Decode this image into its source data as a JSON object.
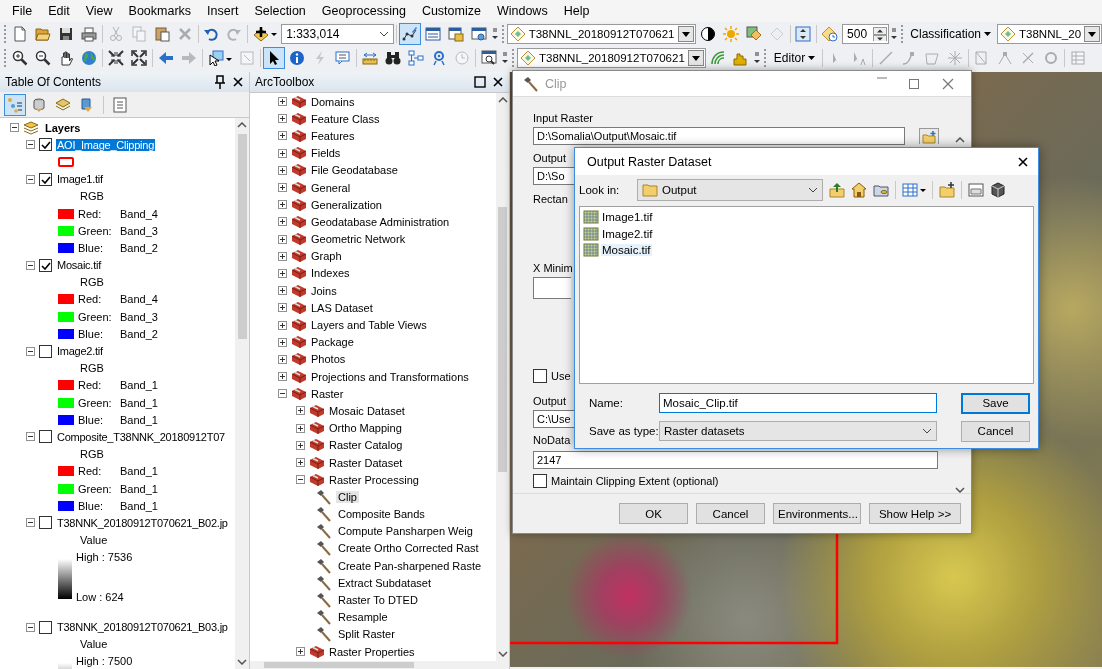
{
  "menu": [
    "File",
    "Edit",
    "View",
    "Bookmarks",
    "Insert",
    "Selection",
    "Geoprocessing",
    "Customize",
    "Windows",
    "Help"
  ],
  "toolbars": [
    {
      "items": [
        {
          "kind": "grip"
        },
        {
          "kind": "button",
          "disabled": false,
          "pressed": false
        },
        {
          "kind": "button",
          "disabled": false,
          "pressed": false
        },
        {
          "kind": "button",
          "disabled": false,
          "pressed": false
        },
        {
          "kind": "button",
          "disabled": false,
          "pressed": false
        },
        {
          "kind": "sep"
        },
        {
          "kind": "button",
          "disabled": true,
          "pressed": false
        },
        {
          "kind": "button",
          "disabled": true,
          "pressed": false
        },
        {
          "kind": "button",
          "disabled": false,
          "pressed": false
        },
        {
          "kind": "button",
          "disabled": true,
          "pressed": false
        },
        {
          "kind": "sep"
        },
        {
          "kind": "button",
          "disabled": false,
          "pressed": false
        },
        {
          "kind": "button",
          "disabled": true,
          "pressed": false
        },
        {
          "kind": "sep"
        },
        {
          "kind": "button",
          "disabled": false,
          "pressed": false
        },
        {
          "kind": "combo",
          "value": "1:333,014"
        },
        {
          "kind": "sep"
        },
        {
          "kind": "button",
          "disabled": false,
          "pressed": true
        },
        {
          "kind": "button",
          "disabled": false,
          "pressed": false
        },
        {
          "kind": "button",
          "disabled": false,
          "pressed": false
        },
        {
          "kind": "button",
          "disabled": false,
          "pressed": false
        },
        {
          "kind": "options"
        },
        {
          "kind": "grip"
        },
        {
          "kind": "dropdown",
          "value": "T38NNL_20180912T070621"
        },
        {
          "kind": "button",
          "disabled": false,
          "pressed": false
        },
        {
          "kind": "button",
          "disabled": false,
          "pressed": false
        },
        {
          "kind": "button",
          "disabled": false,
          "pressed": false
        },
        {
          "kind": "button",
          "disabled": true,
          "pressed": false
        },
        {
          "kind": "sep"
        },
        {
          "kind": "button",
          "disabled": false,
          "pressed": false
        },
        {
          "kind": "sep"
        },
        {
          "kind": "button",
          "disabled": false,
          "pressed": false
        },
        {
          "kind": "spin",
          "value": "500"
        },
        {
          "kind": "options"
        },
        {
          "kind": "grip"
        },
        {
          "kind": "menu",
          "label": "Classification"
        },
        {
          "kind": "dropdown",
          "value": "T38NNL_20"
        }
      ]
    },
    {
      "items": [
        {
          "kind": "grip"
        },
        {
          "kind": "button",
          "disabled": false,
          "pressed": false
        },
        {
          "kind": "button",
          "disabled": false,
          "pressed": false
        },
        {
          "kind": "button",
          "disabled": false,
          "pressed": false
        },
        {
          "kind": "button",
          "disabled": false,
          "pressed": false
        },
        {
          "kind": "sep"
        },
        {
          "kind": "button",
          "disabled": false,
          "pressed": false
        },
        {
          "kind": "button",
          "disabled": false,
          "pressed": false
        },
        {
          "kind": "sep"
        },
        {
          "kind": "button",
          "disabled": false,
          "pressed": false
        },
        {
          "kind": "button",
          "disabled": true,
          "pressed": false
        },
        {
          "kind": "sep"
        },
        {
          "kind": "button",
          "disabled": false,
          "pressed": false
        },
        {
          "kind": "button",
          "disabled": true,
          "pressed": false
        },
        {
          "kind": "sep"
        },
        {
          "kind": "button",
          "disabled": false,
          "pressed": true
        },
        {
          "kind": "button",
          "disabled": false,
          "pressed": false
        },
        {
          "kind": "button",
          "disabled": true,
          "pressed": false
        },
        {
          "kind": "button",
          "disabled": false,
          "pressed": false
        },
        {
          "kind": "sep"
        },
        {
          "kind": "button",
          "disabled": false,
          "pressed": false
        },
        {
          "kind": "button",
          "disabled": false,
          "pressed": false
        },
        {
          "kind": "button",
          "disabled": false,
          "pressed": false
        },
        {
          "kind": "button",
          "disabled": false,
          "pressed": false
        },
        {
          "kind": "button",
          "disabled": true,
          "pressed": false
        },
        {
          "kind": "sep"
        },
        {
          "kind": "button",
          "disabled": false,
          "pressed": false
        },
        {
          "kind": "options"
        },
        {
          "kind": "grip"
        },
        {
          "kind": "dropdown",
          "value": "T38NNL_20180912T070621"
        },
        {
          "kind": "button",
          "disabled": false,
          "pressed": false
        },
        {
          "kind": "button",
          "disabled": false,
          "pressed": false
        },
        {
          "kind": "options"
        },
        {
          "kind": "grip"
        },
        {
          "kind": "menu",
          "label": "Editor"
        },
        {
          "kind": "sep"
        },
        {
          "kind": "button",
          "disabled": true,
          "pressed": false
        },
        {
          "kind": "button",
          "disabled": true,
          "pressed": false
        },
        {
          "kind": "sep"
        },
        {
          "kind": "button",
          "disabled": true,
          "pressed": false
        },
        {
          "kind": "button",
          "disabled": true,
          "pressed": false
        },
        {
          "kind": "button",
          "disabled": true,
          "pressed": false
        },
        {
          "kind": "button",
          "disabled": true,
          "pressed": false
        },
        {
          "kind": "sep"
        },
        {
          "kind": "button",
          "disabled": true,
          "pressed": false
        },
        {
          "kind": "button",
          "disabled": true,
          "pressed": false
        },
        {
          "kind": "button",
          "disabled": true,
          "pressed": false
        },
        {
          "kind": "button",
          "disabled": true,
          "pressed": false
        },
        {
          "kind": "sep"
        },
        {
          "kind": "button",
          "disabled": true,
          "pressed": false
        }
      ]
    }
  ],
  "toc": {
    "title": "Table Of Contents",
    "views": [
      {
        "selected": true
      },
      {
        "selected": false
      },
      {
        "selected": false
      },
      {
        "selected": false
      }
    ],
    "root": {
      "label": "Layers",
      "expanded": true
    },
    "layers": [
      {
        "name": "AOI_Image_Clipping",
        "checked": true,
        "selected": true,
        "expanded": true,
        "legend": [
          {
            "kind": "outline",
            "color": "#ff0000"
          }
        ]
      },
      {
        "name": "Image1.tif",
        "checked": true,
        "selected": false,
        "expanded": true,
        "legend": [
          {
            "kind": "heading",
            "text": "RGB"
          },
          {
            "kind": "band",
            "label": "Red:",
            "value": "Band_4",
            "color": "#ff0000"
          },
          {
            "kind": "band",
            "label": "Green:",
            "value": "Band_3",
            "color": "#00ff00"
          },
          {
            "kind": "band",
            "label": "Blue:",
            "value": "Band_2",
            "color": "#0000ff"
          }
        ]
      },
      {
        "name": "Mosaic.tif",
        "checked": true,
        "selected": false,
        "expanded": true,
        "legend": [
          {
            "kind": "heading",
            "text": "RGB"
          },
          {
            "kind": "band",
            "label": "Red:",
            "value": "Band_4",
            "color": "#ff0000"
          },
          {
            "kind": "band",
            "label": "Green:",
            "value": "Band_3",
            "color": "#00ff00"
          },
          {
            "kind": "band",
            "label": "Blue:",
            "value": "Band_2",
            "color": "#0000ff"
          }
        ]
      },
      {
        "name": "Image2.tif",
        "checked": false,
        "selected": false,
        "expanded": true,
        "legend": [
          {
            "kind": "heading",
            "text": "RGB"
          },
          {
            "kind": "band",
            "label": "Red:",
            "value": "Band_1",
            "color": "#ff0000"
          },
          {
            "kind": "band",
            "label": "Green:",
            "value": "Band_1",
            "color": "#00ff00"
          },
          {
            "kind": "band",
            "label": "Blue:",
            "value": "Band_1",
            "color": "#0000ff"
          }
        ]
      },
      {
        "name": "Composite_T38NNK_20180912T07",
        "checked": false,
        "selected": false,
        "expanded": true,
        "legend": [
          {
            "kind": "heading",
            "text": "RGB"
          },
          {
            "kind": "band",
            "label": "Red:",
            "value": "Band_1",
            "color": "#ff0000"
          },
          {
            "kind": "band",
            "label": "Green:",
            "value": "Band_1",
            "color": "#00ff00"
          },
          {
            "kind": "band",
            "label": "Blue:",
            "value": "Band_1",
            "color": "#0000ff"
          }
        ]
      },
      {
        "name": "T38NNK_20180912T070621_B02.jp",
        "checked": false,
        "selected": false,
        "expanded": true,
        "legend": [
          {
            "kind": "heading",
            "text": "Value"
          },
          {
            "kind": "ramp",
            "high": "High : 7536",
            "low": "Low : 624"
          }
        ]
      },
      {
        "name": "T38NNK_20180912T070621_B03.jp",
        "checked": false,
        "selected": false,
        "expanded": true,
        "legend": [
          {
            "kind": "heading",
            "text": "Value"
          },
          {
            "kind": "ramp",
            "high": "High : 7500"
          }
        ]
      }
    ]
  },
  "toolbox": {
    "title": "ArcToolbox",
    "items": [
      {
        "kind": "toolset",
        "label": "Domains",
        "expanded": false
      },
      {
        "kind": "toolset",
        "label": "Feature Class",
        "expanded": false
      },
      {
        "kind": "toolset",
        "label": "Features",
        "expanded": false
      },
      {
        "kind": "toolset",
        "label": "Fields",
        "expanded": false
      },
      {
        "kind": "toolset",
        "label": "File Geodatabase",
        "expanded": false
      },
      {
        "kind": "toolset",
        "label": "General",
        "expanded": false
      },
      {
        "kind": "toolset",
        "label": "Generalization",
        "expanded": false
      },
      {
        "kind": "toolset",
        "label": "Geodatabase Administration",
        "expanded": false
      },
      {
        "kind": "toolset",
        "label": "Geometric Network",
        "expanded": false
      },
      {
        "kind": "toolset",
        "label": "Graph",
        "expanded": false
      },
      {
        "kind": "toolset",
        "label": "Indexes",
        "expanded": false
      },
      {
        "kind": "toolset",
        "label": "Joins",
        "expanded": false
      },
      {
        "kind": "toolset",
        "label": "LAS Dataset",
        "expanded": false
      },
      {
        "kind": "toolset",
        "label": "Layers and Table Views",
        "expanded": false
      },
      {
        "kind": "toolset",
        "label": "Package",
        "expanded": false
      },
      {
        "kind": "toolset",
        "label": "Photos",
        "expanded": false
      },
      {
        "kind": "toolset",
        "label": "Projections and Transformations",
        "expanded": false
      },
      {
        "kind": "toolset",
        "label": "Raster",
        "expanded": true,
        "children": [
          {
            "kind": "toolset",
            "label": "Mosaic Dataset",
            "expanded": false
          },
          {
            "kind": "toolset",
            "label": "Ortho Mapping",
            "expanded": false
          },
          {
            "kind": "toolset",
            "label": "Raster Catalog",
            "expanded": false
          },
          {
            "kind": "toolset",
            "label": "Raster Dataset",
            "expanded": false
          },
          {
            "kind": "toolset",
            "label": "Raster Processing",
            "expanded": true,
            "children": [
              {
                "kind": "tool",
                "label": "Clip",
                "selected": true
              },
              {
                "kind": "tool",
                "label": "Composite Bands",
                "selected": false
              },
              {
                "kind": "tool",
                "label": "Compute Pansharpen Weig",
                "selected": false
              },
              {
                "kind": "tool",
                "label": "Create Ortho Corrected Rast",
                "selected": false
              },
              {
                "kind": "tool",
                "label": "Create Pan-sharpened Raste",
                "selected": false
              },
              {
                "kind": "tool",
                "label": "Extract Subdataset",
                "selected": false
              },
              {
                "kind": "tool",
                "label": "Raster To DTED",
                "selected": false
              },
              {
                "kind": "tool",
                "label": "Resample",
                "selected": false
              },
              {
                "kind": "tool",
                "label": "Split Raster",
                "selected": false
              }
            ]
          },
          {
            "kind": "toolset",
            "label": "Raster Properties",
            "expanded": false
          }
        ]
      }
    ]
  },
  "clip_dialog": {
    "title": "Clip",
    "input_raster_label": "Input Raster",
    "input_raster_value": "D:\\Somalia\\Output\\Mosaic.tif",
    "output_extent_label": "Output",
    "output_extent_value": "D:\\So",
    "rectangle_label": "Rectan",
    "x_min_label": "X Minim",
    "use_checkbox": {
      "label": "Use",
      "checked": false
    },
    "output_dataset_label": "Output",
    "output_dataset_value": "C:\\Use",
    "nodata_label": "NoData",
    "nodata_value": "2147",
    "maintain_checkbox": {
      "label": "Maintain Clipping Extent (optional)",
      "checked": false
    },
    "buttons": [
      "OK",
      "Cancel",
      "Environments...",
      "Show Help >>"
    ]
  },
  "save_dialog": {
    "title": "Output Raster Dataset",
    "look_in_label": "Look in:",
    "look_in_value": "Output",
    "files": [
      {
        "name": "Image1.tif",
        "selected": false
      },
      {
        "name": "Image2.tif",
        "selected": false
      },
      {
        "name": "Mosaic.tif",
        "selected": true
      }
    ],
    "name_label": "Name:",
    "name_value": "Mosaic_Clip.tif",
    "type_label": "Save as type:",
    "type_value": "Raster datasets",
    "buttons": [
      {
        "label": "Save",
        "default": true
      },
      {
        "label": "Cancel",
        "default": false
      }
    ]
  }
}
